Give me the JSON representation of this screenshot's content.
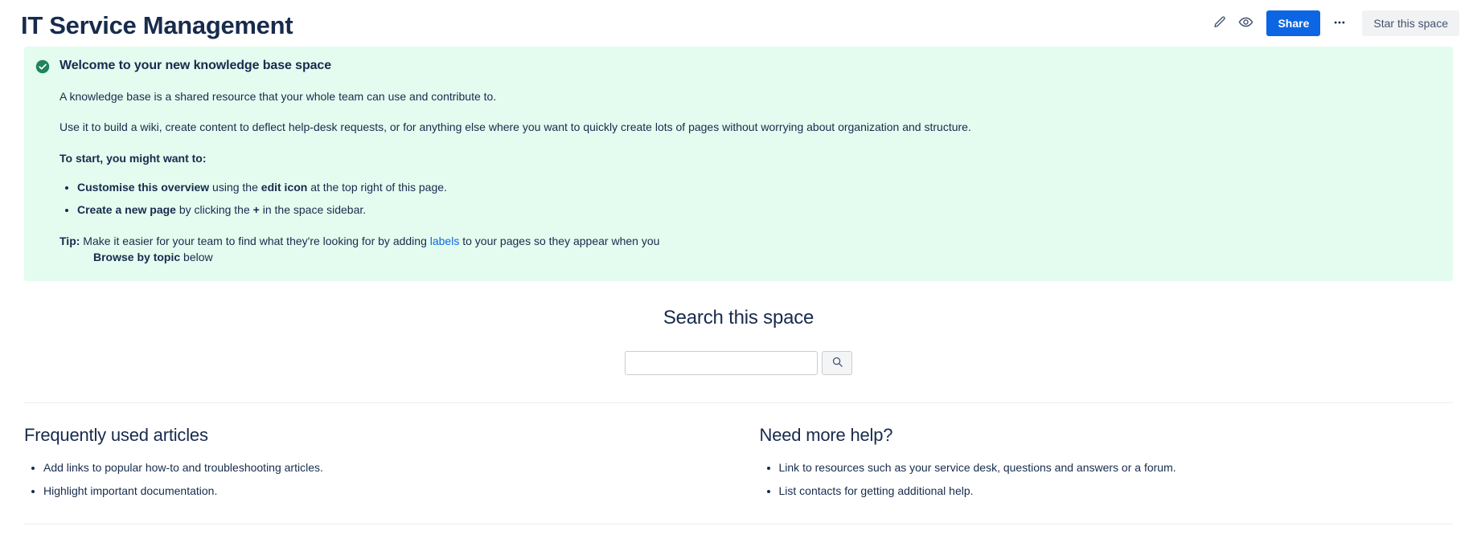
{
  "header": {
    "title": "IT Service Management",
    "actions": {
      "edit_icon": "pencil-icon",
      "watch_icon": "eye-icon",
      "share_label": "Share",
      "more_icon": "more-ellipsis-icon",
      "star_label": "Star this space"
    }
  },
  "welcome_panel": {
    "status_icon": "check-circle-icon",
    "accent_color": "#E3FCEF",
    "icon_color": "#1F845A",
    "title": "Welcome to your new knowledge base space",
    "paragraph_1": "A knowledge base is a shared resource that your whole team can use and contribute to.",
    "paragraph_2": "Use it to build a wiki, create content to deflect help-desk requests, or for anything else where you want to quickly create lots of pages without worrying about organization and structure.",
    "to_start_label": "To start, you might want to:",
    "bullets": [
      {
        "bold_lead": "Customise this overview",
        "mid": " using the ",
        "bold_mid": "edit icon",
        "tail": " at the top right of this page."
      },
      {
        "bold_lead": "Create a new page",
        "mid": " by clicking the ",
        "bold_mid": "+",
        "tail": " in the space sidebar."
      }
    ],
    "tip": {
      "label": "Tip:",
      "text_before_link": " Make it easier for your team to find what they're looking for by adding ",
      "link_text": "labels",
      "link_color": "#0C66E4",
      "text_after_link": " to your pages so they appear when you",
      "second_line_bold": "Browse by topic",
      "second_line_tail": " below"
    }
  },
  "search": {
    "heading": "Search this space",
    "value": "",
    "placeholder": "",
    "button_icon": "search-icon"
  },
  "columns": [
    {
      "heading": "Frequently used articles",
      "items": [
        "Add links to popular how-to and troubleshooting articles.",
        "Highlight important documentation."
      ]
    },
    {
      "heading": "Need more help?",
      "items": [
        "Link to resources such as your service desk, questions and answers or a forum.",
        "List contacts for getting additional help."
      ]
    }
  ]
}
